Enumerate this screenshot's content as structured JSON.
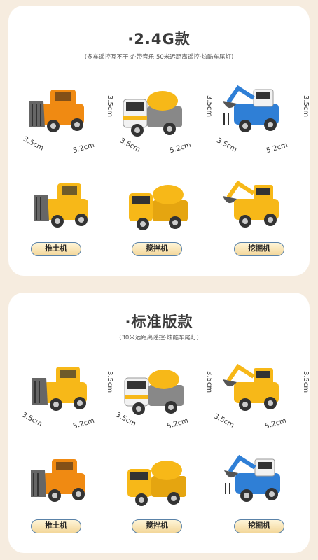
{
  "sections": [
    {
      "title": "·2.4G款",
      "subtitle": "(多车遥控互不干扰·带音乐·50米远距离遥控·炫酷车尾灯)",
      "dims": {
        "height": "3.5cm",
        "depth": "3.5cm",
        "length": "5.2cm"
      },
      "labels": [
        "推土机",
        "搅拌机",
        "挖掘机"
      ]
    },
    {
      "title": "·标准版款",
      "subtitle": "(30米远距离遥控·炫酷车尾灯)",
      "dims": {
        "height": "3.5cm",
        "depth": "3.5cm",
        "length": "5.2cm"
      },
      "labels": [
        "推土机",
        "搅拌机",
        "挖掘机"
      ]
    }
  ],
  "colors": {
    "orange": "#f08a12",
    "yellow": "#f7b818",
    "blue": "#2f7fd6",
    "white": "#f2f2f2",
    "gray": "#777777"
  }
}
